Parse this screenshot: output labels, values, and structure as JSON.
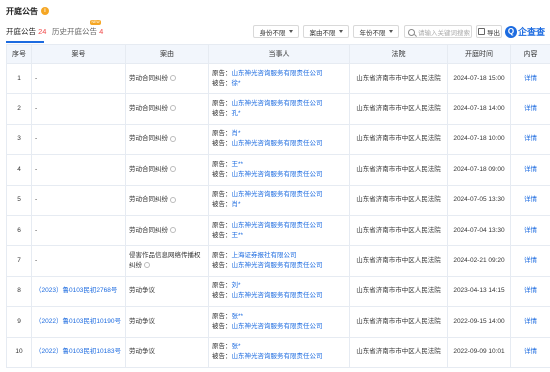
{
  "title": "开庭公告",
  "tabs": [
    {
      "label": "开庭公告",
      "count": "24"
    },
    {
      "label": "历史开庭公告",
      "count": "4",
      "badge": "NEW"
    }
  ],
  "filters": [
    "身份不限",
    "案由不限",
    "年份不限"
  ],
  "search_placeholder": "请输入关键词搜索",
  "export_label": "导出",
  "logo_text": "企查查",
  "columns": [
    "序号",
    "案号",
    "案由",
    "当事人",
    "法院",
    "开庭时间",
    "内容"
  ],
  "rows": [
    {
      "no": "1",
      "case_no": "-",
      "cause": "劳动合同纠纷",
      "help": true,
      "p1_label": "原告：",
      "p1": "山东神光咨询服务有限责任公司",
      "p2_label": "被告：",
      "p2": "徐*",
      "court": "山东省济南市市中区人民法院",
      "time": "2024-07-18 15:00",
      "detail": "详情"
    },
    {
      "no": "2",
      "case_no": "-",
      "cause": "劳动合同纠纷",
      "help": true,
      "p1_label": "原告：",
      "p1": "山东神光咨询服务有限责任公司",
      "p2_label": "被告：",
      "p2": "孔*",
      "court": "山东省济南市市中区人民法院",
      "time": "2024-07-18 14:00",
      "detail": "详情"
    },
    {
      "no": "3",
      "case_no": "-",
      "cause": "劳动合同纠纷",
      "help": true,
      "p1_label": "原告：",
      "p1": "肖*",
      "p2_label": "被告：",
      "p2": "山东神光咨询服务有限责任公司",
      "court": "山东省济南市市中区人民法院",
      "time": "2024-07-18 10:00",
      "detail": "详情"
    },
    {
      "no": "4",
      "case_no": "-",
      "cause": "劳动合同纠纷",
      "help": true,
      "p1_label": "原告：",
      "p1": "王**",
      "p2_label": "被告：",
      "p2": "山东神光咨询服务有限责任公司",
      "court": "山东省济南市市中区人民法院",
      "time": "2024-07-18 09:00",
      "detail": "详情"
    },
    {
      "no": "5",
      "case_no": "-",
      "cause": "劳动合同纠纷",
      "help": true,
      "p1_label": "原告：",
      "p1": "山东神光咨询服务有限责任公司",
      "p2_label": "被告：",
      "p2": "肖*",
      "court": "山东省济南市市中区人民法院",
      "time": "2024-07-05 13:30",
      "detail": "详情"
    },
    {
      "no": "6",
      "case_no": "-",
      "cause": "劳动合同纠纷",
      "help": true,
      "p1_label": "原告：",
      "p1": "山东神光咨询服务有限责任公司",
      "p2_label": "被告：",
      "p2": "王**",
      "court": "山东省济南市市中区人民法院",
      "time": "2024-07-04 13:30",
      "detail": "详情"
    },
    {
      "no": "7",
      "case_no": "-",
      "cause": "侵害作品信息网络传播权纠纷",
      "help": true,
      "p1_label": "原告：",
      "p1": "上海证券报社有限公司",
      "p2_label": "被告：",
      "p2": "山东神光咨询服务有限责任公司",
      "court": "山东省济南市市中区人民法院",
      "time": "2024-02-21 09:20",
      "detail": "详情"
    },
    {
      "no": "8",
      "case_no": "（2023）鲁0103民初2768号",
      "cause": "劳动争议",
      "help": false,
      "p1_label": "原告：",
      "p1": "刘*",
      "p2_label": "被告：",
      "p2": "山东神光咨询服务有限责任公司",
      "court": "山东省济南市市中区人民法院",
      "time": "2023-04-13 14:15",
      "detail": "详情"
    },
    {
      "no": "9",
      "case_no": "（2022）鲁0103民初10190号",
      "cause": "劳动争议",
      "help": false,
      "p1_label": "原告：",
      "p1": "张**",
      "p2_label": "被告：",
      "p2": "山东神光咨询服务有限责任公司",
      "court": "山东省济南市市中区人民法院",
      "time": "2022-09-15 14:00",
      "detail": "详情"
    },
    {
      "no": "10",
      "case_no": "（2022）鲁0103民初10183号",
      "cause": "劳动争议",
      "help": false,
      "p1_label": "原告：",
      "p1": "张*",
      "p2_label": "被告：",
      "p2": "山东神光咨询服务有限责任公司",
      "court": "山东省济南市市中区人民法院",
      "time": "2022-09-09 10:01",
      "detail": "详情"
    }
  ]
}
